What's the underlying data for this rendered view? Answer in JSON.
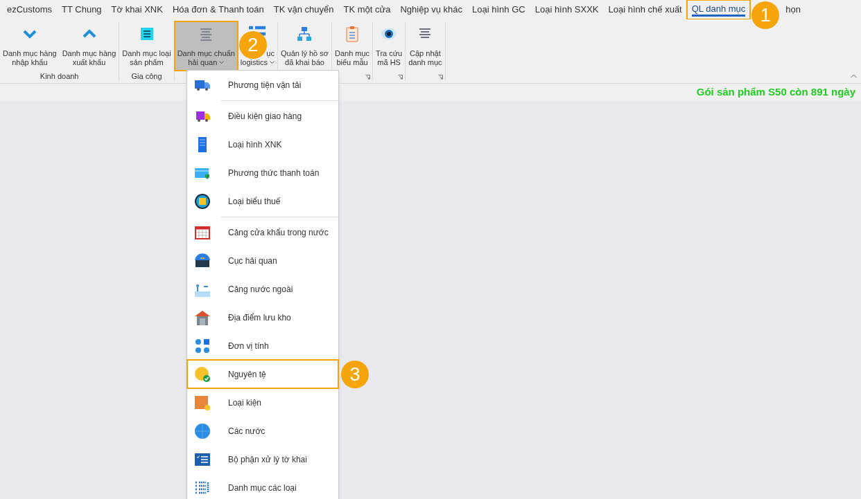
{
  "tabs": [
    {
      "label": "ezCustoms",
      "selected": false,
      "highlighted": false
    },
    {
      "label": "TT Chung",
      "selected": false,
      "highlighted": false
    },
    {
      "label": "Tờ khai XNK",
      "selected": false,
      "highlighted": false
    },
    {
      "label": "Hóa đơn & Thanh toán",
      "selected": false,
      "highlighted": false
    },
    {
      "label": "TK vận chuyển",
      "selected": false,
      "highlighted": false
    },
    {
      "label": "TK một cửa",
      "selected": false,
      "highlighted": false
    },
    {
      "label": "Nghiệp vụ khác",
      "selected": false,
      "highlighted": false
    },
    {
      "label": "Loại hình GC",
      "selected": false,
      "highlighted": false
    },
    {
      "label": "Loại hình SXXK",
      "selected": false,
      "highlighted": false
    },
    {
      "label": "Loại hình chế xuất",
      "selected": false,
      "highlighted": false
    },
    {
      "label": "QL danh mục",
      "selected": true,
      "highlighted": true,
      "callout": "1"
    },
    {
      "label": "họn",
      "selected": false,
      "highlighted": false
    }
  ],
  "ribbon": {
    "groups": [
      {
        "label": "Kinh doanh",
        "launcher": false,
        "buttons": [
          {
            "lines": [
              "Danh mục hàng",
              "nhập khẩu"
            ],
            "dropdown": false,
            "highlighted": false
          },
          {
            "lines": [
              "Danh mục hàng",
              "xuất khẩu"
            ],
            "dropdown": false,
            "highlighted": false
          }
        ]
      },
      {
        "label": "Gia công",
        "launcher": false,
        "buttons": [
          {
            "lines": [
              "Danh mục loại",
              "sản phẩm"
            ],
            "dropdown": false,
            "highlighted": false
          }
        ]
      },
      {
        "launcher": false,
        "buttons": [
          {
            "lines": [
              "Danh mục chuẩn",
              "hải quan"
            ],
            "dropdown": true,
            "highlighted": true,
            "callout": "2"
          },
          {
            "lines": [
              "ục",
              "logistics"
            ],
            "dropdown": true,
            "highlighted": false
          }
        ]
      },
      {
        "buttons": [
          {
            "lines": [
              "Quản lý hồ sơ",
              "đã khai báo"
            ],
            "dropdown": false,
            "highlighted": false
          }
        ]
      },
      {
        "launcher": true,
        "buttons": [
          {
            "lines": [
              "Danh mục",
              "biểu mẫu"
            ],
            "dropdown": false,
            "highlighted": false
          }
        ]
      },
      {
        "launcher": true,
        "buttons": [
          {
            "lines": [
              "Tra cứu",
              "mã HS"
            ],
            "dropdown": false,
            "highlighted": false
          }
        ]
      },
      {
        "launcher": true,
        "buttons": [
          {
            "lines": [
              "Cập nhật",
              "danh mục"
            ],
            "dropdown": false,
            "highlighted": false
          }
        ]
      }
    ]
  },
  "status": "Gói sản phẩm S50 còn 891 ngày",
  "menu": {
    "sections": [
      {
        "items": [
          {
            "label": "Phương tiện vận tải",
            "highlighted": false
          }
        ]
      },
      {
        "items": [
          {
            "label": "Điều kiện giao hàng",
            "highlighted": false
          },
          {
            "label": "Loại hình XNK",
            "highlighted": false
          },
          {
            "label": "Phương thức thanh toán",
            "highlighted": false
          },
          {
            "label": "Loại biểu thuế",
            "highlighted": false
          }
        ]
      },
      {
        "items": [
          {
            "label": "Cảng cửa khẩu trong nước",
            "highlighted": false
          },
          {
            "label": "Cục hải quan",
            "highlighted": false
          },
          {
            "label": "Cảng nước ngoài",
            "highlighted": false
          },
          {
            "label": "Địa điểm lưu kho",
            "highlighted": false
          },
          {
            "label": "Đơn vị tính",
            "highlighted": false
          },
          {
            "label": "Nguyên tệ",
            "highlighted": true,
            "callout": "3"
          },
          {
            "label": "Loại kiện",
            "highlighted": false
          },
          {
            "label": "Các nước",
            "highlighted": false
          },
          {
            "label": "Bộ phận xử lý tờ khai",
            "highlighted": false
          },
          {
            "label": "Danh mục các loại",
            "highlighted": false
          }
        ]
      }
    ]
  }
}
